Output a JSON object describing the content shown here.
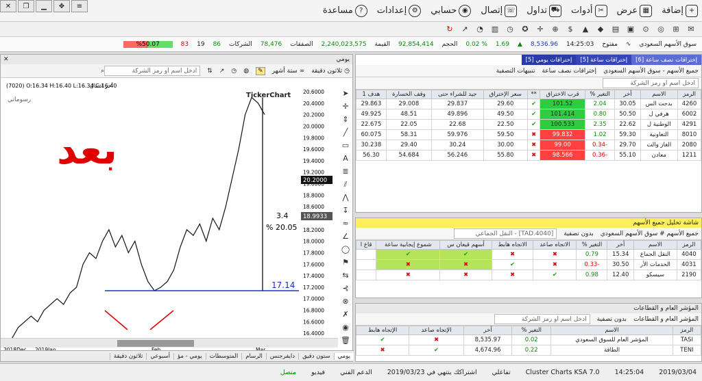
{
  "menu": {
    "items": [
      "إضافة",
      "عرض",
      "أدوات",
      "تداول",
      "إتصال",
      "حسابي",
      "إعدادات",
      "مساعدة"
    ]
  },
  "ticker": {
    "market": "سوق الأسهم السعودي",
    "time": "14:25:03",
    "status": "مفتوح",
    "index": "8,536.96",
    "change": "1.69",
    "change_pct": "% 0.02",
    "volume_label": "الحجم",
    "volume": "92,854,414",
    "value_label": "القيمة",
    "value": "2,240,023,575",
    "trades_label": "الصفقات",
    "trades": "78,476",
    "companies_label": "الشركات",
    "up": "86",
    "flat": "19",
    "down": "83",
    "pct_box": "%50.07"
  },
  "chart": {
    "header": "يومي",
    "toolbar": [
      "ثلاثون دقيقة",
      "ستة أشهر"
    ],
    "search_placeholder": "ادخل اسم او رمز الشركة",
    "ohlc": "(7020) O:16.34 H:16.40 L:16.34 C:16.40",
    "ohlc_tag": "أخر اتصال",
    "drawing_label": "رسوماتي",
    "brand": "TickerChart",
    "overlay_text": "بعد",
    "measure_value": "3.4",
    "measure_pct": "% 20.05",
    "support_label": "17.14",
    "last_price": "20.2000",
    "cursor_price": "18.9933",
    "x_labels": [
      "2018Dec",
      "2019Jan",
      "Feb",
      "Mar"
    ],
    "y_labels": [
      "20.6000",
      "20.4000",
      "20.2000",
      "20.0000",
      "19.8000",
      "19.6000",
      "19.4000",
      "19.2000",
      "19.0000",
      "18.8000",
      "18.6000",
      "18.4000",
      "18.2000",
      "18.0000",
      "17.8000",
      "17.6000",
      "17.4000",
      "17.2000",
      "17.0000",
      "16.8000",
      "16.6000",
      "16.4000",
      "16.2000"
    ],
    "tabs": [
      "يومي",
      "ستون دقيق",
      "دايفرجنس",
      "الرسام",
      "المتوسطات",
      "يومي - مؤ",
      "أسبوعي",
      "ثلاثون دقيقة"
    ]
  },
  "chart_data": {
    "type": "line",
    "x": [
      "2018Dec",
      "2019Jan",
      "Feb",
      "Mar"
    ],
    "y": [
      16.3,
      16.5,
      16.6,
      16.7,
      16.6,
      16.8,
      16.9,
      17.0,
      16.9,
      17.1,
      17.2,
      17.6,
      17.8,
      17.7,
      18.0,
      18.2,
      17.9,
      18.1,
      17.8,
      18.0,
      17.6,
      17.3,
      17.14,
      17.2,
      17.3,
      17.5,
      17.9,
      18.2,
      18.1,
      18.3,
      18.0,
      18.4,
      18.2,
      18.6,
      19.1,
      19.6,
      20.2,
      20.5,
      20.4,
      20.2
    ],
    "ylim": [
      16.2,
      20.6
    ],
    "annotations": [
      "17.14",
      "3.4",
      "% 20.05",
      "بعد"
    ]
  },
  "panel1": {
    "tabs": [
      "إختراقات نصف ساعة [6]",
      "إختراقات ساعة [5]",
      "إختراقات يومي [5]"
    ],
    "market": "جميع الأسهم - سوق الأسهم السعودي",
    "filters": [
      "إختراقات نصف ساعة",
      "تنبيهات التصفية"
    ],
    "search_placeholder": "ادخل اسم او رمز الشركة",
    "columns": [
      "الرمز",
      "الاسم",
      "أخر",
      "التغير %",
      "قرب الاختراق",
      "**",
      "سعر الإختراق",
      "جيد للشراء حتى",
      "وقف الخسارة",
      "هدف 1"
    ],
    "rows": [
      [
        "4260",
        "بدجت الس",
        "30.05",
        "2.04",
        "101.52",
        "✔",
        "29.60",
        "29.837",
        "29.008",
        "29.863",
        "g"
      ],
      [
        "6002",
        "هرفي ل",
        "50.50",
        "0.80",
        "101.414",
        "✔",
        "49.50",
        "49.896",
        "48.51",
        "49.925",
        "g"
      ],
      [
        "4291",
        "الوطنية ل",
        "22.62",
        "2.35",
        "100.533",
        "✔",
        "22.50",
        "22.68",
        "22.05",
        "22.675",
        "g"
      ],
      [
        "8010",
        "التعاونية",
        "59.30",
        "1.02",
        "99.832",
        "✖",
        "59.50",
        "59.976",
        "58.31",
        "60.075",
        "r"
      ],
      [
        "2080",
        "الغاز والت",
        "29.70",
        "-0.34",
        "99.00",
        "✖",
        "30.00",
        "30.24",
        "29.40",
        "30.238",
        "r"
      ],
      [
        "1211",
        "معادن",
        "55.10",
        "-0.36",
        "98.566",
        "✖",
        "55.80",
        "56.246",
        "54.684",
        "56.30",
        "r"
      ]
    ]
  },
  "panel2": {
    "title": "شاشة تحليل جميع الأسهم",
    "market": "جميع الأسهم # سوق الأسهم السعودي",
    "filter": "بدون تصفية",
    "search_value": "[TAD.4040] - النقل الجماعي",
    "columns": [
      "الرمز",
      "الاسم",
      "أخر",
      "التغير %",
      "الاتجاه صاعد",
      "الاتجاه هابط",
      "أسهم قيعان س",
      "شموع إيجابية ساعة",
      "قاع ا"
    ],
    "rows": [
      [
        "4040",
        "النقل الجماع",
        "15.34",
        "0.79",
        "✖",
        "✖",
        "✔",
        "✔"
      ],
      [
        "4031",
        "الخدمات الأر",
        "30.50",
        "-0.33",
        "✖",
        "✔",
        "✖",
        "✖"
      ],
      [
        "2190",
        "سيسكو",
        "12.40",
        "0.98",
        "✔",
        "✖",
        "✖",
        "✖"
      ]
    ]
  },
  "panel3": {
    "title": "المؤشر العام و القطاعات",
    "market": "المؤشر العام و القطاعات",
    "filter": "بدون تصفية",
    "search_placeholder": "ادخل اسم او رمز الشركة",
    "columns": [
      "الرمز",
      "الاسم",
      "التغير %",
      "أخر",
      "الإتجاه صاعد",
      "الإتجاه هابط"
    ],
    "rows": [
      [
        "TASI",
        "المؤشر العام للسوق السعودي",
        "0.02",
        "8,535.97",
        "✖",
        "✔"
      ],
      [
        "TENI",
        "الطاقة",
        "0.22",
        "4,674.96",
        "✔",
        "✖"
      ]
    ]
  },
  "status": {
    "date": "2019/03/04",
    "time": "14:25:04",
    "product": "Cluster Charts KSA 7.0",
    "mode": "تفاعلي",
    "expiry": "اشتراكك ينتهي في 2019/03/23",
    "support": "الدعم الفني",
    "video": "فيديو",
    "connected": "متصل"
  }
}
